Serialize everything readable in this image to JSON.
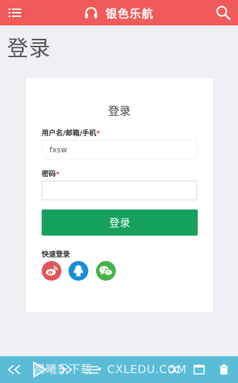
{
  "header": {
    "app_title": "银色乐航"
  },
  "page": {
    "title": "登录"
  },
  "form": {
    "title": "登录",
    "username_label": "用户名/邮箱/手机",
    "username_value": "fxsw",
    "password_label": "密码",
    "password_value": "",
    "required_mark": "*",
    "submit_label": "登录",
    "quick_login_label": "快速登录",
    "quick_login_providers": [
      "weibo",
      "qq",
      "wechat"
    ]
  },
  "watermark": {
    "text": "晨曦乐下载 • CXLEDU.COM"
  },
  "icons": [
    "menu-icon",
    "headphones-icon",
    "search-icon",
    "weibo-icon",
    "qq-icon",
    "wechat-icon",
    "skip-back-icon",
    "play-icon",
    "skip-forward-icon",
    "playlist-icon",
    "shuffle-icon",
    "window-icon",
    "trash-icon"
  ],
  "colors": {
    "header_bg": "#f05a5a",
    "submit_bg": "#16a05d",
    "required": "#e04040",
    "weibo": "#e05758",
    "qq": "#1a8dd8",
    "wechat": "#44b549",
    "player_bg": "#5bbcd8"
  }
}
